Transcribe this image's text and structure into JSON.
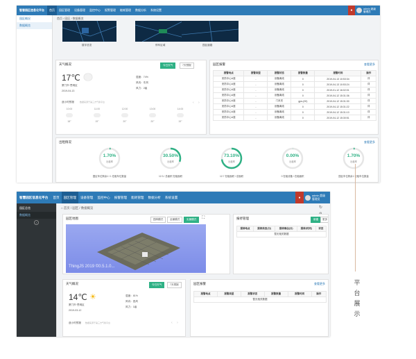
{
  "app": {
    "title": "智慧园区信息化平台",
    "user_label": "admin 超级管理员"
  },
  "nav": [
    "首页",
    "园区管理",
    "设备管理",
    "监控中心",
    "报警管理",
    "能耗管理",
    "数据分析",
    "系统设置"
  ],
  "top": {
    "sidebar": {
      "section": "园区概况",
      "item": "数据概览"
    },
    "breadcrumb": [
      "首页",
      "园区",
      "数据概览"
    ],
    "maps": [
      "楼宇总览",
      "停车区域",
      "园区道路"
    ],
    "weather": {
      "title": "天气概况",
      "tabs": [
        "今日天气",
        "7天预报"
      ],
      "temp": "17℃",
      "location": "厦门市·思明区",
      "date": "2019-04-13",
      "humidity_label": "湿度：",
      "humidity": "74%",
      "wind_label": "风向：",
      "wind": "东风",
      "level_label": "风力：",
      "level": "2级",
      "forecast_title": "逐小时预报",
      "forecast_note": "数据来源于第三方气象平台",
      "hours": [
        "10:00",
        "11:00",
        "12:00",
        "13:00",
        "14:00"
      ],
      "hour_temps": [
        "18°",
        "19°",
        "20°",
        "20°",
        "19°"
      ]
    },
    "alarms": {
      "title": "园区报警",
      "more": "查看更多",
      "columns": [
        "报警地点",
        "报警类型",
        "报警状态",
        "报警数量",
        "报警时间",
        "操作"
      ],
      "rows": [
        [
          "安防中心A座",
          "-",
          "设备离线",
          "0",
          "2019-04-13 10:53:34",
          "详"
        ],
        [
          "安防中心A座",
          "-",
          "设备离线",
          "0",
          "2019-04-13 10:53:24",
          "详"
        ],
        [
          "安防中心A座",
          "-",
          "设备离线",
          "0",
          "2019-01-12 16:02:01",
          "详"
        ],
        [
          "安防中心A座",
          "-",
          "设备离线",
          "0",
          "2019-04-12 15:31:36",
          "详"
        ],
        [
          "安防中心A座",
          "-",
          "门未关",
          "gps-(00)",
          "2019-04-12 15:31:30",
          "详"
        ],
        [
          "安防中心A座",
          "-",
          "设备离线",
          "0",
          "2019-04-12 15:31:22",
          "详"
        ],
        [
          "安防中心A座",
          "-",
          "设备离线",
          "0",
          "2019-04-12 15:31:10",
          "详"
        ],
        [
          "安防中心A座",
          "-",
          "设备离线",
          "0",
          "2019-04-12 15:30:51",
          "详"
        ]
      ]
    },
    "energy": {
      "title": "出租情况",
      "more": "查看更多",
      "items": [
        {
          "value": "1.70%",
          "fraction": 0.017,
          "sub": "出租率",
          "caption": "园区车位剩余1 / 1 在租车位数量"
        },
        {
          "value": "30.50%",
          "fraction": 0.305,
          "sub": "出租率",
          "caption": "12.3 / 总面积 在租面积"
        },
        {
          "value": "73.10%",
          "fraction": 0.731,
          "sub": "出租率",
          "caption": "12.7 在租面积 / 总面积"
        },
        {
          "value": "0.00%",
          "fraction": 0.0,
          "sub": "出租率",
          "caption": "0 在租设备 / 在租面积"
        },
        {
          "value": "1.70%",
          "fraction": 0.017,
          "sub": "出租率",
          "caption": "园区车位剩余1 在租车位数量"
        }
      ]
    }
  },
  "bottom": {
    "sidebar": {
      "section": "园区总览",
      "item": "数据概览"
    },
    "breadcrumb": [
      "首页",
      "园区",
      "数据概览"
    ],
    "map": {
      "title": "园区地图",
      "modes": [
        "园林模式",
        "全景模式",
        "实景模式"
      ],
      "watermark": "ThingJS 2019 ©0.5.1.0..."
    },
    "repair": {
      "title": "报修管理",
      "btns": [
        "新建",
        "更多"
      ],
      "columns": [
        "报修地点",
        "报修类目(分)",
        "报修事由(分)",
        "报修(时间)",
        "状态"
      ],
      "empty": "暂无相关数据"
    },
    "weather": {
      "title": "天气概况",
      "tabs": [
        "今日天气",
        "7天预报"
      ],
      "temp": "14℃",
      "location": "厦门市·思明区",
      "date": "2019-03-12",
      "humidity_label": "湿度：",
      "humidity": "81%",
      "wind_label": "风向：",
      "wind": "西风",
      "level_label": "风力：",
      "level": "1级",
      "forecast_title": "逐小时预报",
      "forecast_note": "数据来源于第三方气象平台"
    },
    "alarms": {
      "title": "园区报警",
      "more": "查看更多",
      "columns": [
        "报警地点",
        "报警类型",
        "报警状态",
        "报警数量",
        "报警时间",
        "操作"
      ],
      "empty": "暂无相关数据"
    }
  },
  "side_label": [
    "平",
    "台",
    "展",
    "示"
  ],
  "colors": {
    "topbar": "#2e7bb7",
    "accent": "#2fb185",
    "danger": "#c0392b"
  }
}
